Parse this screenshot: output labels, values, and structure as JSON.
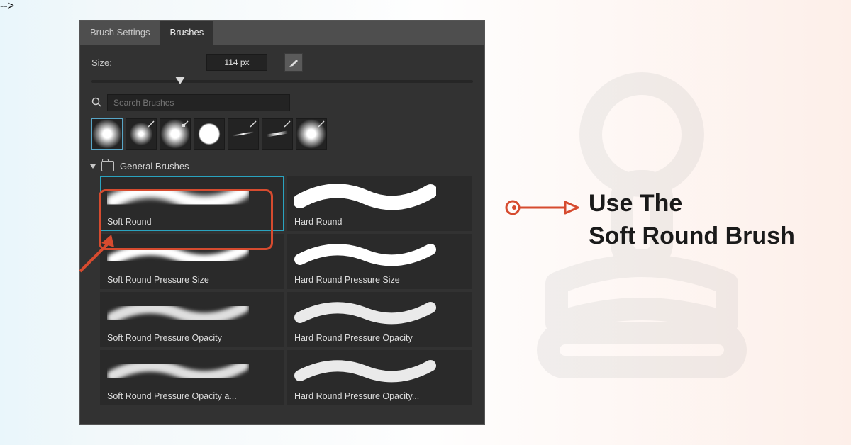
{
  "headline": {
    "line1": "Use The",
    "line2": "Soft Round Brush"
  },
  "tabs": {
    "settings": "Brush Settings",
    "brushes": "Brushes"
  },
  "size": {
    "label": "Size:",
    "value": "114 px"
  },
  "search": {
    "placeholder": "Search Brushes"
  },
  "folder": {
    "name": "General Brushes"
  },
  "brushes": {
    "soft_round": "Soft Round",
    "hard_round": "Hard Round",
    "soft_ps": "Soft Round Pressure Size",
    "hard_ps": "Hard Round Pressure Size",
    "soft_po": "Soft Round Pressure Opacity",
    "hard_po": "Hard Round Pressure Opacity",
    "soft_poa": "Soft Round Pressure Opacity a...",
    "hard_poa": "Hard Round Pressure Opacity..."
  },
  "colors": {
    "accent": "#d64b2f",
    "select": "#2aa3bf"
  }
}
